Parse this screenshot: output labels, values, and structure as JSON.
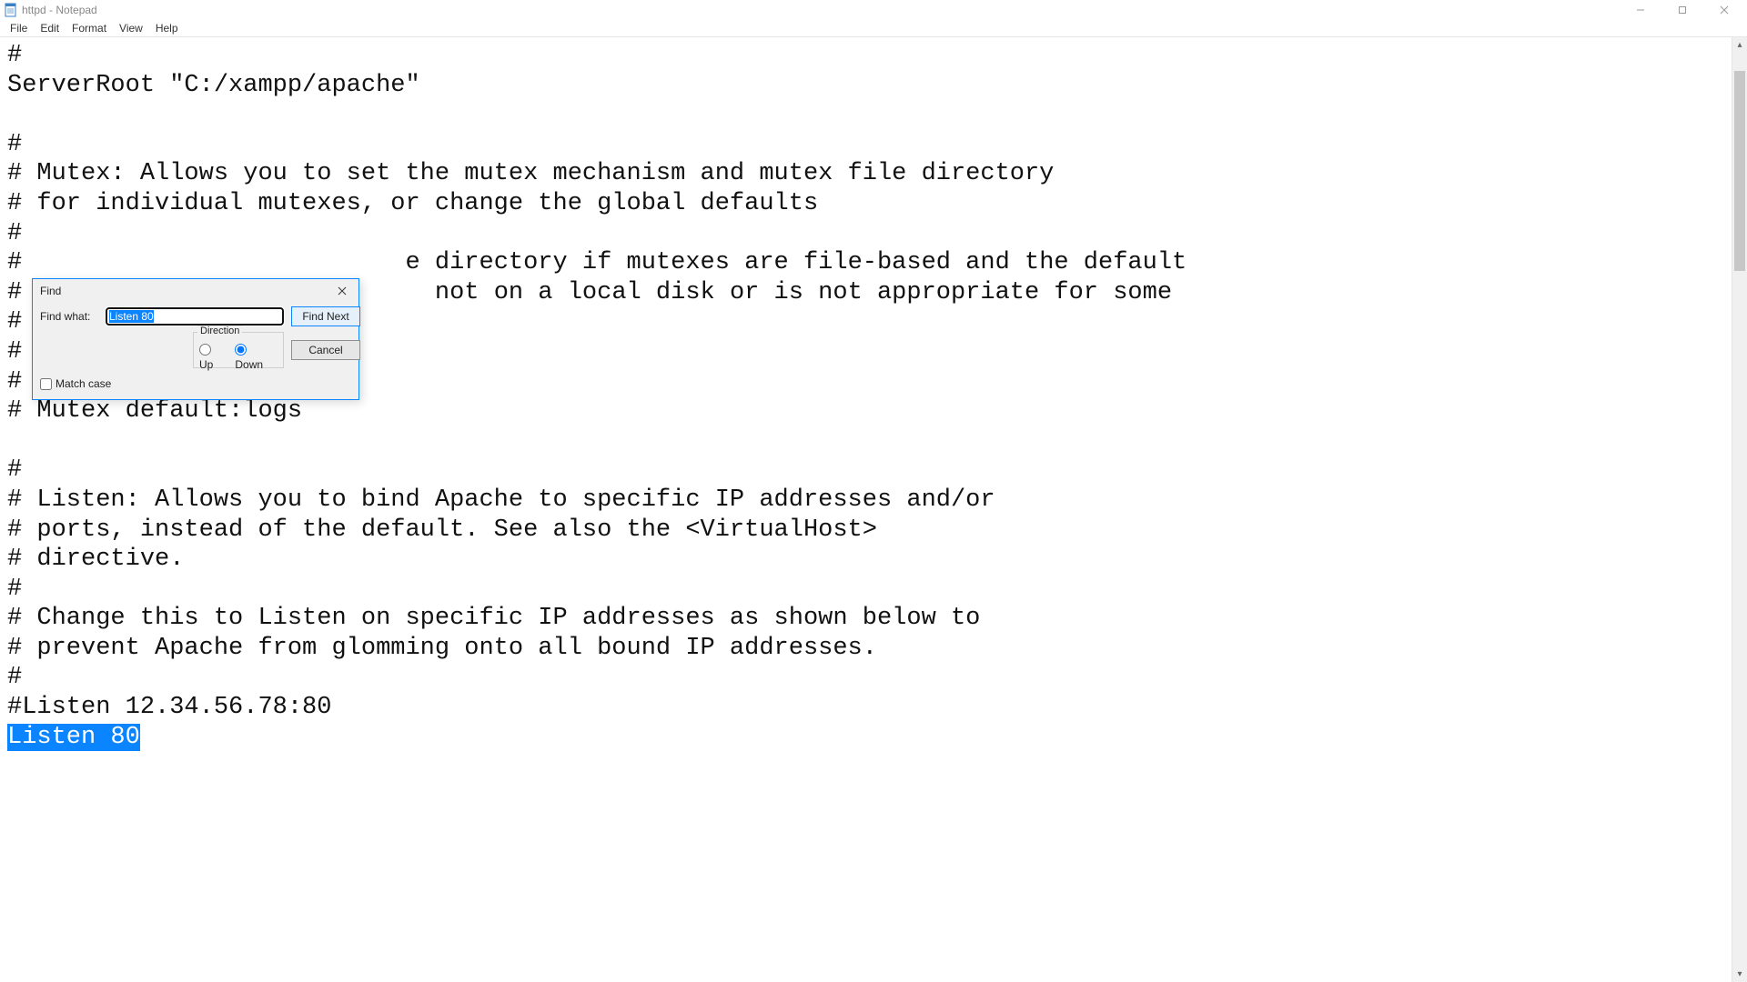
{
  "window": {
    "title": "httpd - Notepad"
  },
  "menu": {
    "file": "File",
    "edit": "Edit",
    "format": "Format",
    "view": "View",
    "help": "Help"
  },
  "editor": {
    "line01": "#",
    "line02": "ServerRoot \"C:/xampp/apache\"",
    "line03": "",
    "line04": "#",
    "line05": "# Mutex: Allows you to set the mutex mechanism and mutex file directory",
    "line06": "# for individual mutexes, or change the global defaults",
    "line07": "#",
    "line08_a": "#",
    "line08_b": "e directory if mutexes are file-based and the default",
    "line09_a": "#",
    "line09_b": "not on a local disk or is not appropriate for some",
    "line10": "#",
    "line11": "#",
    "line12": "#",
    "line13": "# Mutex default:logs",
    "line14": "",
    "line15": "#",
    "line16": "# Listen: Allows you to bind Apache to specific IP addresses and/or",
    "line17": "# ports, instead of the default. See also the <VirtualHost>",
    "line18": "# directive.",
    "line19": "#",
    "line20": "# Change this to Listen on specific IP addresses as shown below to ",
    "line21": "# prevent Apache from glomming onto all bound IP addresses.",
    "line22": "#",
    "line23": "#Listen 12.34.56.78:80",
    "line24_hl": "Listen 80"
  },
  "find": {
    "title": "Find",
    "find_what_label": "Find what:",
    "find_what_value": "Listen 80",
    "find_next": "Find Next",
    "cancel": "Cancel",
    "direction_label": "Direction",
    "up": "Up",
    "down": "Down",
    "direction_selected": "down",
    "match_case": "Match case",
    "match_case_checked": false
  }
}
